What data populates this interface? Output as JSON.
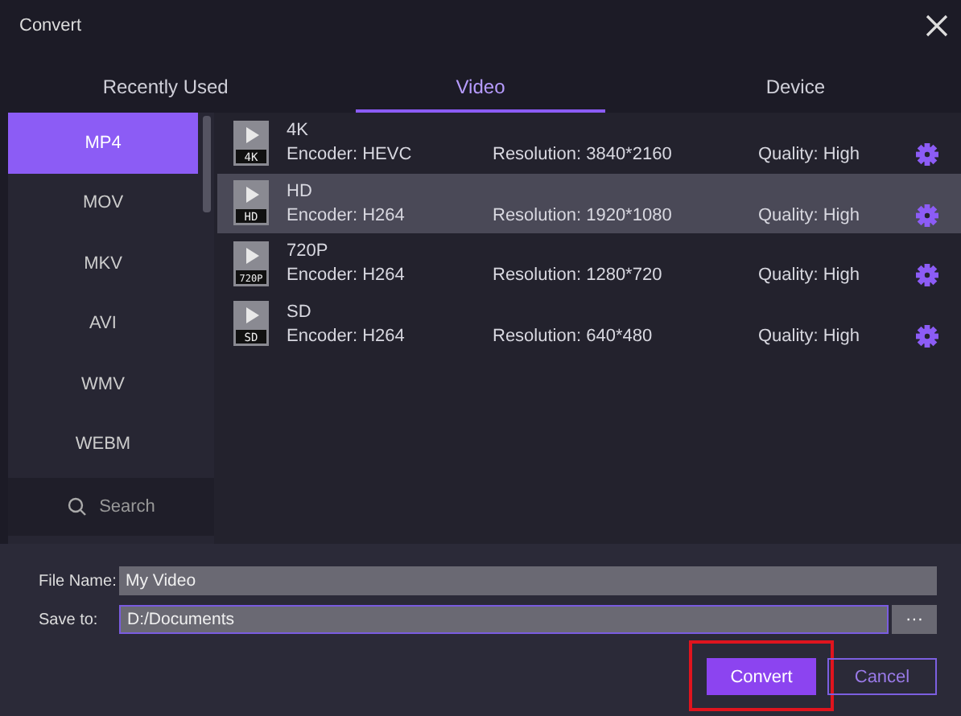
{
  "window": {
    "title": "Convert"
  },
  "tabs": [
    {
      "label": "Recently Used",
      "selected": false
    },
    {
      "label": "Video",
      "selected": true
    },
    {
      "label": "Device",
      "selected": false
    }
  ],
  "formats": [
    {
      "label": "MP4",
      "selected": true
    },
    {
      "label": "MOV",
      "selected": false
    },
    {
      "label": "MKV",
      "selected": false
    },
    {
      "label": "AVI",
      "selected": false
    },
    {
      "label": "WMV",
      "selected": false
    },
    {
      "label": "WEBM",
      "selected": false
    }
  ],
  "search": {
    "placeholder": "Search"
  },
  "presets": [
    {
      "name": "4K",
      "badge": "4K",
      "encoder": "Encoder: HEVC",
      "resolution": "Resolution: 3840*2160",
      "quality": "Quality: High",
      "selected": false
    },
    {
      "name": "HD",
      "badge": "HD",
      "encoder": "Encoder: H264",
      "resolution": "Resolution: 1920*1080",
      "quality": "Quality: High",
      "selected": true
    },
    {
      "name": "720P",
      "badge": "720P",
      "encoder": "Encoder: H264",
      "resolution": "Resolution: 1280*720",
      "quality": "Quality: High",
      "selected": false
    },
    {
      "name": "SD",
      "badge": "SD",
      "encoder": "Encoder: H264",
      "resolution": "Resolution: 640*480",
      "quality": "Quality: High",
      "selected": false
    }
  ],
  "file_name": {
    "label": "File Name:",
    "value": "My Video"
  },
  "save_to": {
    "label": "Save to:",
    "value": "D:/Documents",
    "browse": "···"
  },
  "buttons": [
    {
      "label": "Convert",
      "kind": "primary",
      "highlighted": true
    },
    {
      "label": "Cancel",
      "kind": "secondary",
      "highlighted": false
    }
  ]
}
